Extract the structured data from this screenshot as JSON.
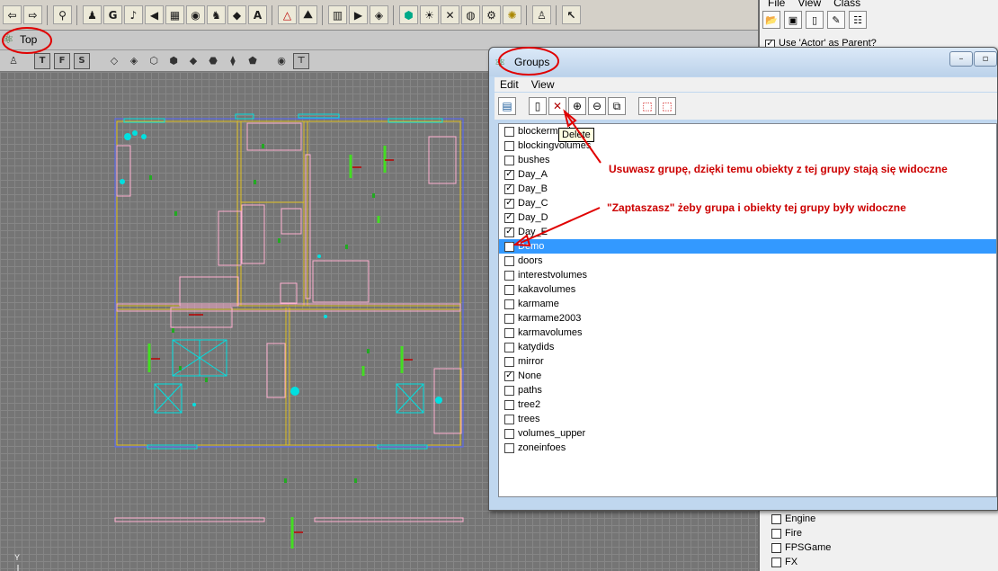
{
  "toolbar": {
    "icons": [
      "arrow-left-right-icon",
      "binoculars-icon",
      "actor-icon",
      "g-icon",
      "music-icon",
      "speaker-icon",
      "texture-icon",
      "eye-icon",
      "mesh-icon",
      "static-mesh-icon",
      "font-icon",
      "triangle-icon",
      "terrain-icon",
      "prefab-icon",
      "play-icon",
      "shield-icon",
      "mover-icon",
      "eye2-icon",
      "sliders-icon",
      "light-icon",
      "build-icon",
      "help-cursor-icon"
    ],
    "g_label": "G",
    "a_label": "A"
  },
  "viewport": {
    "title": "Top",
    "mode_buttons": [
      "T",
      "F",
      "S"
    ],
    "axis_label": "Y"
  },
  "right_panel": {
    "menu": [
      "File",
      "View",
      "Class"
    ],
    "use_actor_label": "Use 'Actor' as Parent?",
    "items": [
      {
        "label": "Engine",
        "checked": false
      },
      {
        "label": "Fire",
        "checked": false
      },
      {
        "label": "FPSGame",
        "checked": false
      },
      {
        "label": "FX",
        "checked": false
      }
    ]
  },
  "groups_window": {
    "title": "Groups",
    "menu": [
      "Edit",
      "View"
    ],
    "tooltip": "Delete",
    "items": [
      {
        "label": "blockermeshes",
        "checked": false,
        "selected": false
      },
      {
        "label": "blockingvolumes",
        "checked": false,
        "selected": false
      },
      {
        "label": "bushes",
        "checked": false,
        "selected": false
      },
      {
        "label": "Day_A",
        "checked": true,
        "selected": false
      },
      {
        "label": "Day_B",
        "checked": true,
        "selected": false
      },
      {
        "label": "Day_C",
        "checked": true,
        "selected": false
      },
      {
        "label": "Day_D",
        "checked": true,
        "selected": false
      },
      {
        "label": "Day_E",
        "checked": true,
        "selected": false
      },
      {
        "label": "Demo",
        "checked": true,
        "selected": true
      },
      {
        "label": "doors",
        "checked": false,
        "selected": false
      },
      {
        "label": "interestvolumes",
        "checked": false,
        "selected": false
      },
      {
        "label": "kakavolumes",
        "checked": false,
        "selected": false
      },
      {
        "label": "karmame",
        "checked": false,
        "selected": false
      },
      {
        "label": "karmame2003",
        "checked": false,
        "selected": false
      },
      {
        "label": "karmavolumes",
        "checked": false,
        "selected": false
      },
      {
        "label": "katydids",
        "checked": false,
        "selected": false
      },
      {
        "label": "mirror",
        "checked": false,
        "selected": false
      },
      {
        "label": "None",
        "checked": true,
        "selected": false
      },
      {
        "label": "paths",
        "checked": false,
        "selected": false
      },
      {
        "label": "tree2",
        "checked": false,
        "selected": false
      },
      {
        "label": "trees",
        "checked": false,
        "selected": false
      },
      {
        "label": "volumes_upper",
        "checked": false,
        "selected": false
      },
      {
        "label": "zoneinfoes",
        "checked": false,
        "selected": false
      }
    ]
  },
  "annotations": {
    "delete_note": "Usuwasz grupę, dzięki temu obiekty z tej grupy stają się widoczne",
    "check_note": "\"Zaptaszasz\" żeby grupa i obiekty tej  grupy były widoczne"
  },
  "colors": {
    "annotation": "#cc0000",
    "selection": "#3399ff",
    "grid": "#757575"
  }
}
